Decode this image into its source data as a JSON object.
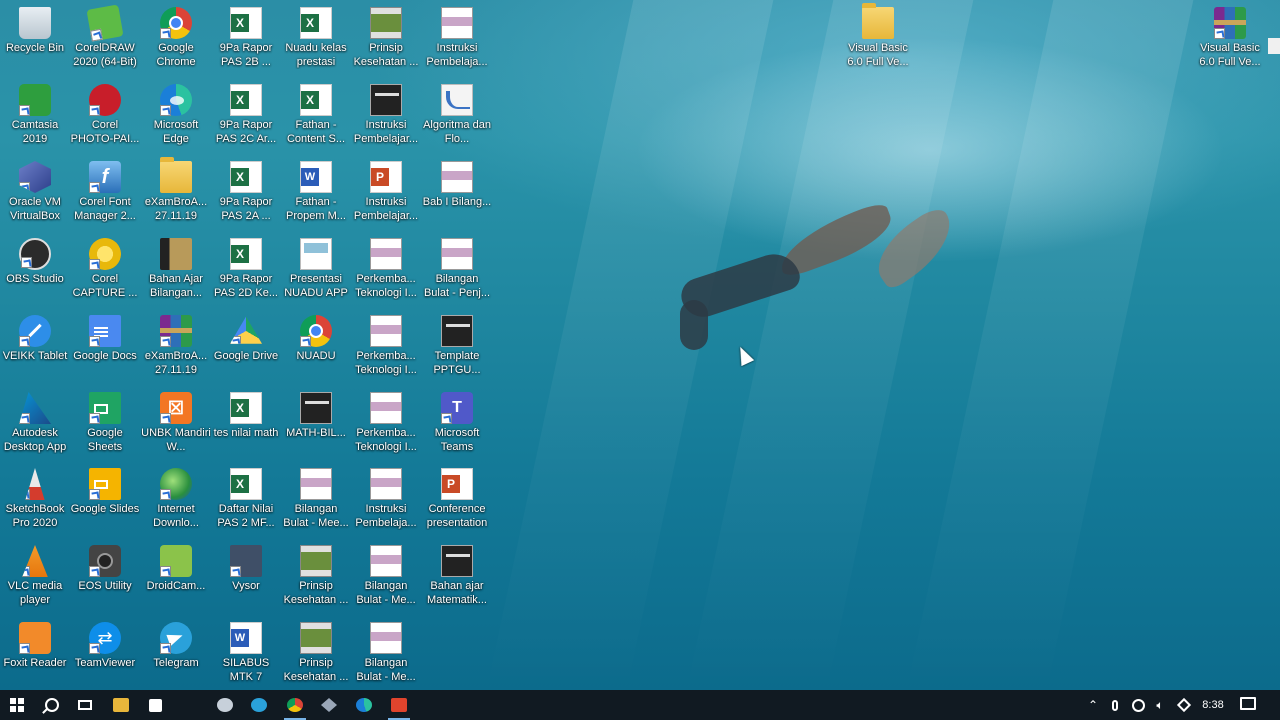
{
  "desktop": {
    "icons_col1": [
      {
        "label": "Recycle Bin",
        "icon": "recycle-bin-icon"
      },
      {
        "label": "Camtasia 2019",
        "icon": "camtasia-icon"
      },
      {
        "label": "Oracle VM VirtualBox",
        "icon": "virtualbox-icon"
      },
      {
        "label": "OBS Studio",
        "icon": "obs-icon"
      },
      {
        "label": "VEIKK Tablet",
        "icon": "veikk-icon"
      },
      {
        "label": "Autodesk Desktop App",
        "icon": "autodesk-icon"
      },
      {
        "label": "SketchBook Pro 2020",
        "icon": "sketchbook-icon"
      },
      {
        "label": "VLC media player",
        "icon": "vlc-icon"
      },
      {
        "label": "Foxit Reader",
        "icon": "foxit-icon"
      }
    ],
    "icons_col2": [
      {
        "label": "CorelDRAW 2020 (64-Bit)",
        "icon": "coreldraw-icon"
      },
      {
        "label": "Corel PHOTO-PAI...",
        "icon": "corel-photopaint-icon"
      },
      {
        "label": "Corel Font Manager 2...",
        "icon": "corel-font-icon"
      },
      {
        "label": "Corel CAPTURE ...",
        "icon": "corel-capture-icon"
      },
      {
        "label": "Google Docs",
        "icon": "google-docs-icon"
      },
      {
        "label": "Google Sheets",
        "icon": "google-sheets-icon"
      },
      {
        "label": "Google Slides",
        "icon": "google-slides-icon"
      },
      {
        "label": "EOS Utility",
        "icon": "eos-icon"
      },
      {
        "label": "TeamViewer",
        "icon": "teamviewer-icon"
      }
    ],
    "icons_col3": [
      {
        "label": "Google Chrome",
        "icon": "chrome-icon"
      },
      {
        "label": "Microsoft Edge",
        "icon": "edge-icon"
      },
      {
        "label": "eXamBroA... 27.11.19",
        "icon": "folder-icon"
      },
      {
        "label": "Bahan Ajar Bilangan...",
        "icon": "book-icon"
      },
      {
        "label": "eXamBroA... 27.11.19",
        "icon": "winrar-icon"
      },
      {
        "label": "UNBK Mandiri W...",
        "icon": "xampp-icon"
      },
      {
        "label": "Internet Downlo...",
        "icon": "internet-download-icon"
      },
      {
        "label": "DroidCam...",
        "icon": "droidcam-icon"
      },
      {
        "label": "Telegram",
        "icon": "telegram-icon"
      }
    ],
    "icons_col4": [
      {
        "label": "9Pa Rapor PAS 2B ...",
        "icon": "excel-icon"
      },
      {
        "label": "9Pa Rapor PAS 2C Ar...",
        "icon": "excel-icon"
      },
      {
        "label": "9Pa Rapor PAS 2A ...",
        "icon": "excel-icon"
      },
      {
        "label": "9Pa Rapor PAS 2D Ke...",
        "icon": "excel-icon"
      },
      {
        "label": "Google Drive",
        "icon": "google-drive-icon"
      },
      {
        "label": "tes nilai math",
        "icon": "excel-icon"
      },
      {
        "label": "Daftar Nilai PAS 2 MF...",
        "icon": "excel-icon"
      },
      {
        "label": "Vysor",
        "icon": "vysor-icon"
      },
      {
        "label": "SILABUS MTK 7",
        "icon": "word-icon"
      }
    ],
    "icons_col5": [
      {
        "label": "Nuadu kelas prestasi",
        "icon": "excel-icon"
      },
      {
        "label": "Fathan - Content S...",
        "icon": "excel-icon"
      },
      {
        "label": "Fathan - Propem M...",
        "icon": "word-icon"
      },
      {
        "label": "Presentasi NUADU APP",
        "icon": "nuadu-thumb-icon"
      },
      {
        "label": "NUADU",
        "icon": "chrome-icon"
      },
      {
        "label": "MATH-BIL...",
        "icon": "dark-thumb-icon"
      },
      {
        "label": "Bilangan Bulat - Mee...",
        "icon": "thumb-icon"
      },
      {
        "label": "Prinsip Kesehatan ...",
        "icon": "green-thumb-icon"
      },
      {
        "label": "Prinsip Kesehatan ...",
        "icon": "green-thumb-icon"
      }
    ],
    "icons_col6": [
      {
        "label": "Prinsip Kesehatan ...",
        "icon": "green-thumb-icon"
      },
      {
        "label": "Instruksi Pembelajar...",
        "icon": "dark-thumb-icon"
      },
      {
        "label": "Instruksi Pembelajar...",
        "icon": "powerpoint-icon"
      },
      {
        "label": "Perkemba... Teknologi I...",
        "icon": "thumb-icon"
      },
      {
        "label": "Perkemba... Teknologi I...",
        "icon": "thumb-icon"
      },
      {
        "label": "Perkemba... Teknologi I...",
        "icon": "thumb-icon"
      },
      {
        "label": "Instruksi Pembelaja...",
        "icon": "thumb-icon"
      },
      {
        "label": "Bilangan Bulat - Me...",
        "icon": "thumb-icon"
      },
      {
        "label": "Bilangan Bulat - Me...",
        "icon": "thumb-icon"
      }
    ],
    "icons_col7": [
      {
        "label": "Instruksi Pembelaja...",
        "icon": "thumb-icon"
      },
      {
        "label": "Algoritma dan Flo...",
        "icon": "algo-icon"
      },
      {
        "label": "Bab I Bilang...",
        "icon": "thumb-icon"
      },
      {
        "label": "Bilangan Bulat - Penj...",
        "icon": "thumb-icon"
      },
      {
        "label": "Template PPTGU...",
        "icon": "dark-thumb-icon"
      },
      {
        "label": "Microsoft Teams",
        "icon": "teams-icon"
      },
      {
        "label": "Conference presentation",
        "icon": "powerpoint-icon"
      },
      {
        "label": "Bahan ajar Matematik...",
        "icon": "dark-thumb-icon"
      }
    ],
    "icons_far": [
      {
        "label": "Visual Basic 6.0 Full Ve...",
        "icon": "folder-icon"
      },
      {
        "label": "Visual Basic 6.0 Full Ve...",
        "icon": "winrar-icon"
      }
    ]
  },
  "taskbar": {
    "clock": "8:38",
    "apps": [
      "start",
      "search",
      "task-view",
      "file-explorer",
      "store",
      "app",
      "telegram",
      "chrome",
      "app2",
      "edge",
      "app3"
    ]
  }
}
